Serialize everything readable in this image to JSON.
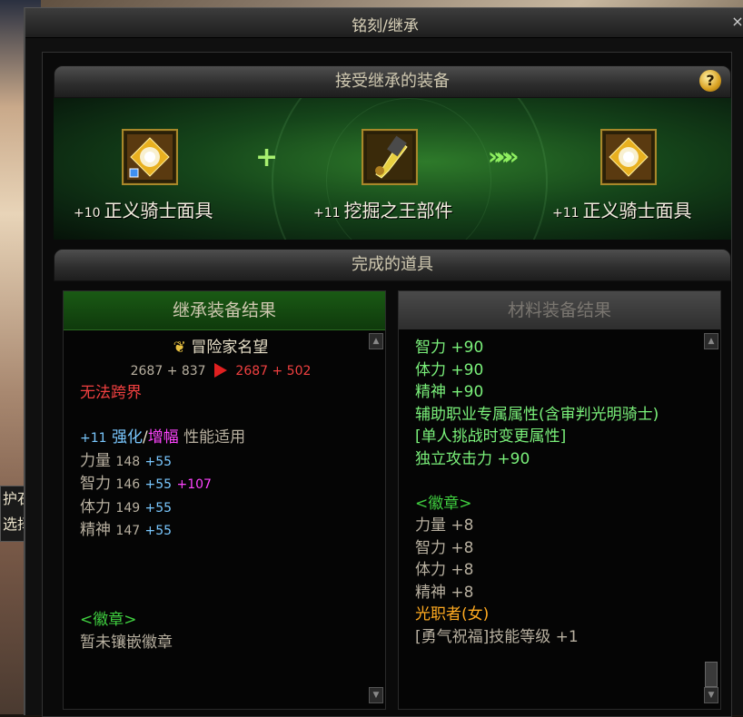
{
  "window": {
    "title": "铭刻/继承",
    "close_label": "×"
  },
  "background": {
    "side_text_1": "护石",
    "side_text_2": "选择"
  },
  "top_section": {
    "header": "接受继承的装备",
    "help_label": "?"
  },
  "items": [
    {
      "level": "+10",
      "name": "正义骑士面具",
      "icon": "knight-mask-icon"
    },
    {
      "level": "+11",
      "name": "挖掘之王部件",
      "icon": "drill-part-icon"
    },
    {
      "level": "+11",
      "name": "正义骑士面具",
      "icon": "knight-mask-icon"
    }
  ],
  "combine": {
    "plus": "+",
    "arrows": "»»»"
  },
  "result_section": {
    "header": "完成的道具"
  },
  "left_panel": {
    "header": "继承装备结果",
    "reputation_label": "冒险家名望",
    "rep_old": "2687 + 837",
    "rep_new": "2687 + 502",
    "cannot_cross": "无法跨界",
    "reinforce": {
      "level": "+11",
      "strengthen": "强化",
      "slash": "/",
      "amplify": "增幅",
      "suffix": "性能适用"
    },
    "stats": [
      {
        "name": "力量",
        "base": "148",
        "bonus": "+55",
        "extra": ""
      },
      {
        "name": "智力",
        "base": "146",
        "bonus": "+55",
        "extra": "+107"
      },
      {
        "name": "体力",
        "base": "149",
        "bonus": "+55",
        "extra": ""
      },
      {
        "name": "精神",
        "base": "147",
        "bonus": "+55",
        "extra": ""
      }
    ],
    "emblem_title": "<徽章>",
    "emblem_empty": "暂未镶嵌徽章"
  },
  "right_panel": {
    "header": "材料装备结果",
    "stats": [
      "智力 +90",
      "体力 +90",
      "精神 +90",
      "辅助职业专属属性(含审判光明骑士)",
      "[单人挑战时变更属性]",
      "独立攻击力 +90"
    ],
    "emblem_title": "<徽章>",
    "emblem_stats": [
      "力量 +8",
      "智力 +8",
      "体力 +8",
      "精神 +8"
    ],
    "class_req": "光职者(女)",
    "skill_line": "[勇气祝福]技能等级 +1"
  },
  "colors": {
    "accent_green": "#7af07a",
    "rep_red": "#f04040",
    "cyan": "#7ac8ff",
    "pink": "#ff44ff"
  }
}
